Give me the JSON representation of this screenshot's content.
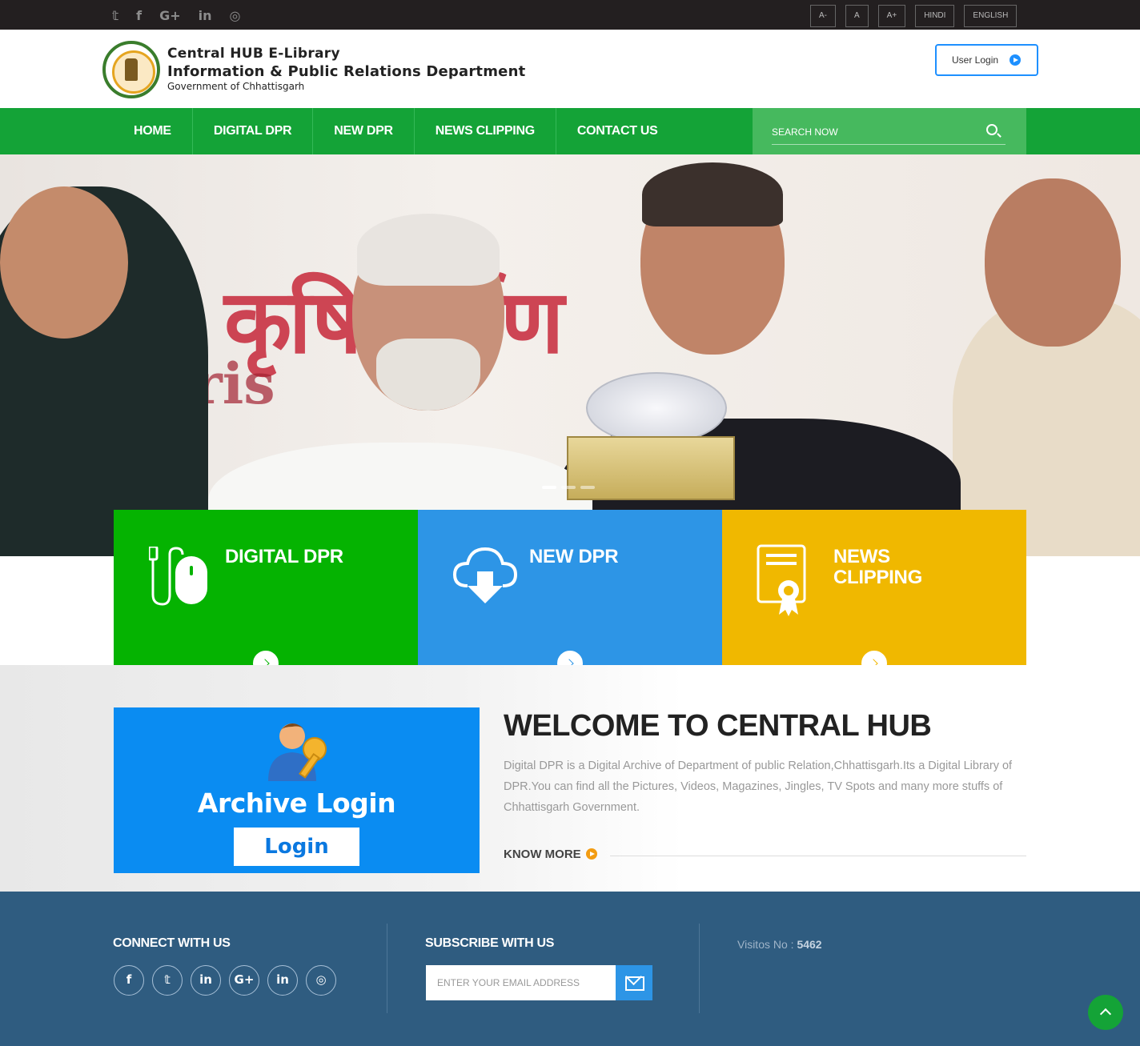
{
  "topbar": {
    "social": [
      "twitter-icon",
      "facebook-icon",
      "google-plus-icon",
      "linkedin-icon",
      "instagram-icon"
    ],
    "social_glyphs": [
      "𝕥",
      "f",
      "G+",
      "in",
      "◎"
    ],
    "font_buttons": [
      "A-",
      "A",
      "A+"
    ],
    "languages": [
      "HINDI",
      "ENGLISH"
    ]
  },
  "header": {
    "line1": "Central HUB E-Library",
    "line2": "Information & Public Relations Department",
    "line3": "Government of Chhattisgarh",
    "user_login": "User Login"
  },
  "nav": {
    "items": [
      "HOME",
      "DIGITAL DPR",
      "NEW DPR",
      "NEWS CLIPPING",
      "CONTACT US"
    ],
    "search_placeholder": "SEARCH NOW"
  },
  "features": [
    {
      "title": "DIGITAL DPR",
      "color": "#05b301",
      "icon": "mouse-icon"
    },
    {
      "title": "NEW DPR",
      "color": "#2d95e6",
      "icon": "cloud-download-icon"
    },
    {
      "title": "NEWS CLIPPING",
      "color": "#f0b800",
      "icon": "certificate-icon"
    }
  ],
  "archive": {
    "title": "Archive Login",
    "button": "Login"
  },
  "welcome": {
    "title": "WELCOME TO CENTRAL HUB",
    "text": "Digital DPR is a Digital Archive of Department of public Relation,Chhattisgarh.Its a Digital Library of DPR.You can find all the Pictures, Videos, Magazines, Jingles, TV Spots and many more stuffs of Chhattisgarh Government.",
    "know_more": "KNOW MORE"
  },
  "footer": {
    "connect_title": "CONNECT WITH US",
    "social_glyphs": [
      "f",
      "𝕥",
      "in",
      "G+",
      "in",
      "◎"
    ],
    "subscribe_title": "SUBSCRIBE WITH US",
    "email_placeholder": "ENTER YOUR EMAIL ADDRESS",
    "visitors_label": "Visitos No : ",
    "visitors_count": "5462"
  },
  "colors": {
    "nav_green": "#14a337",
    "topbar": "#231f20",
    "footer": "#2f5c80",
    "accent_blue": "#2d95e6",
    "accent_yellow": "#f0b800"
  }
}
